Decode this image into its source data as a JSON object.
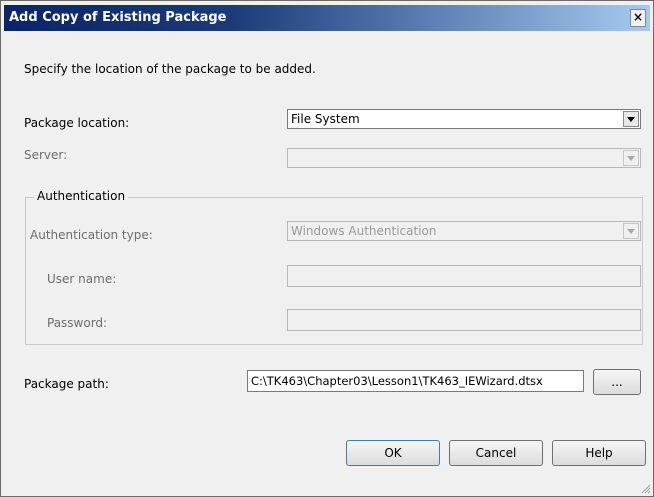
{
  "window": {
    "title": "Add Copy of Existing Package",
    "close_label": "×"
  },
  "instruction": "Specify the location of the package to be added.",
  "package_location": {
    "label": "Package location:",
    "value": "File System"
  },
  "server": {
    "label": "Server:",
    "value": ""
  },
  "authentication": {
    "group_title": "Authentication",
    "type_label": "Authentication type:",
    "type_value": "Windows Authentication",
    "username_label": "User name:",
    "username_value": "",
    "password_label": "Password:",
    "password_value": ""
  },
  "package_path": {
    "label": "Package path:",
    "value": "C:\\TK463\\Chapter03\\Lesson1\\TK463_IEWizard.dtsx",
    "browse_label": "..."
  },
  "buttons": {
    "ok": "OK",
    "cancel": "Cancel",
    "help": "Help"
  }
}
